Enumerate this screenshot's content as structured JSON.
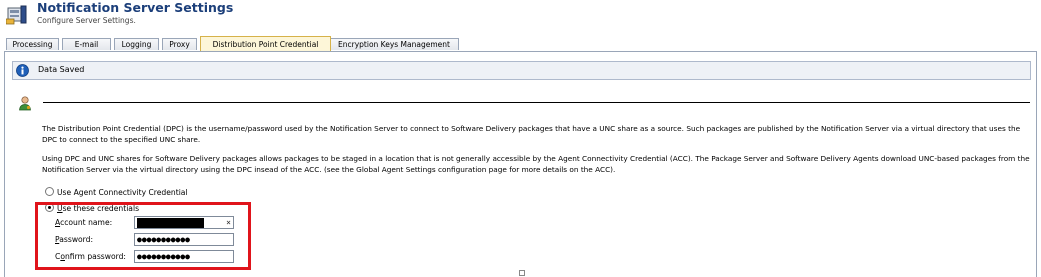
{
  "header": {
    "title": "Notification Server Settings",
    "subtitle": "Configure Server Settings."
  },
  "tabs": [
    {
      "label": "Processing",
      "active": false
    },
    {
      "label": "E-mail",
      "active": false
    },
    {
      "label": "Logging",
      "active": false
    },
    {
      "label": "Proxy",
      "active": false
    },
    {
      "label": "Distribution Point Credential",
      "active": true
    },
    {
      "label": "Encryption Keys Management",
      "active": false
    }
  ],
  "status": {
    "message": "Data Saved",
    "icon": "info-icon"
  },
  "description": {
    "p1": "The Distribution Point Credential (DPC) is the username/password used by the Notification Server to connect to Software Delivery packages that have a UNC share as a source. Such packages are published by the Notification Server via a virtual directory that uses the DPC to connect to the specified UNC share.",
    "p2": "Using DPC and UNC shares for Software Delivery packages allows packages to be staged in a location that is not generally accessible by the Agent Connectivity Credential (ACC). The Package Server and Software Delivery Agents download UNC-based packages from the Notification Server via the virtual directory using the DPC insead of the ACC. (see the Global Agent Settings configuration page for more details on the ACC)."
  },
  "options": {
    "use_acc": {
      "label": "Use Agent Connectivity Credential",
      "selected": false
    },
    "use_these": {
      "label_rest": "se these credentials",
      "label_key": "U",
      "selected": true
    }
  },
  "credentials": {
    "account_name": {
      "label_key": "A",
      "label_rest": "ccount name:",
      "value_redacted": true,
      "clear_glyph": "×"
    },
    "password": {
      "label_key": "P",
      "label_rest": "assword:",
      "value": "●●●●●●●●●●●"
    },
    "confirm_password": {
      "label_pre": "C",
      "label_key": "o",
      "label_rest": "nfirm password:",
      "value": "●●●●●●●●●●●"
    }
  },
  "colors": {
    "title": "#1c3f7a",
    "highlight_border": "#e0141b",
    "active_tab": "#fdf6d8",
    "status_bar": "#eef1f6"
  }
}
